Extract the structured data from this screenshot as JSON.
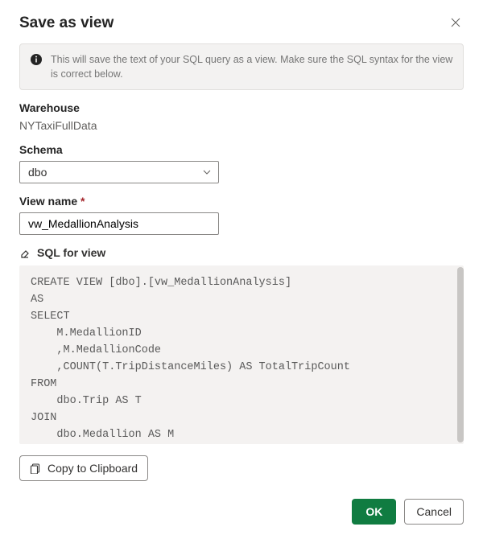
{
  "dialog": {
    "title": "Save as view",
    "info_message": "This will save the text of your SQL query as a view. Make sure the SQL syntax for the view is correct below."
  },
  "warehouse": {
    "label": "Warehouse",
    "value": "NYTaxiFullData"
  },
  "schema": {
    "label": "Schema",
    "selected": "dbo"
  },
  "view_name": {
    "label": "View name",
    "required_marker": "*",
    "value": "vw_MedallionAnalysis"
  },
  "sql_section": {
    "label": "SQL for view",
    "code": "CREATE VIEW [dbo].[vw_MedallionAnalysis]\nAS\nSELECT\n    M.MedallionID\n    ,M.MedallionCode\n    ,COUNT(T.TripDistanceMiles) AS TotalTripCount\nFROM\n    dbo.Trip AS T\nJOIN\n    dbo.Medallion AS M"
  },
  "buttons": {
    "copy": "Copy to Clipboard",
    "ok": "OK",
    "cancel": "Cancel"
  }
}
